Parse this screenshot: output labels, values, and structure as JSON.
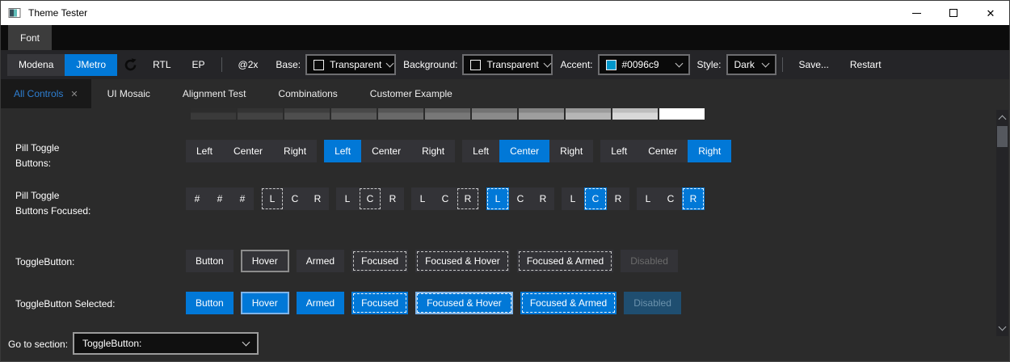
{
  "window": {
    "title": "Theme Tester",
    "controls": {
      "minimize": "minimize",
      "maximize": "maximize",
      "close": "✕"
    }
  },
  "menubar": {
    "font": "Font"
  },
  "toolbar": {
    "modena": "Modena",
    "jmetro": "JMetro",
    "rtl": "RTL",
    "ep": "EP",
    "scale": "@2x",
    "base_label": "Base:",
    "base_value": "Transparent",
    "background_label": "Background:",
    "background_value": "Transparent",
    "accent_label": "Accent:",
    "accent_value": "#0096c9",
    "accent_color": "#0096c9",
    "style_label": "Style:",
    "style_value": "Dark",
    "save": "Save...",
    "restart": "Restart"
  },
  "tabs": [
    {
      "label": "All Controls",
      "close": "✕",
      "selected": true
    },
    {
      "label": "UI Mosaic"
    },
    {
      "label": "Alignment Test"
    },
    {
      "label": "Combinations"
    },
    {
      "label": "Customer Example"
    }
  ],
  "colors": {
    "accent_button_blue": "#0178d7",
    "button_gray": "#333337",
    "disabled_selected_bg": "#1f4e70",
    "content_bg": "#2b2b2b"
  },
  "swatch_strip": {
    "blocks": [
      {
        "top": "#2c2c2c",
        "bottom": "#3a3a3a"
      },
      {
        "top": "#333333",
        "bottom": "#424242"
      },
      {
        "top": "#3d3d3d",
        "bottom": "#4e4e4e"
      },
      {
        "top": "#484848",
        "bottom": "#5a5a5a"
      },
      {
        "top": "#555555",
        "bottom": "#696969"
      },
      {
        "top": "#636363",
        "bottom": "#787878"
      },
      {
        "top": "#737373",
        "bottom": "#8a8a8a"
      },
      {
        "top": "#858585",
        "bottom": "#9e9e9e"
      },
      {
        "top": "#9b9b9b",
        "bottom": "#b6b6b6"
      },
      {
        "top": "#bdbdbd",
        "bottom": "#d8d8d8"
      },
      {
        "top": "#ffffff",
        "bottom": "#ffffff"
      }
    ]
  },
  "rows": {
    "pill": {
      "label": "Pill Toggle Buttons:",
      "groups": [
        {
          "buttons": [
            {
              "label": "Left"
            },
            {
              "label": "Center"
            },
            {
              "label": "Right"
            }
          ]
        },
        {
          "buttons": [
            {
              "label": "Left",
              "state": "selected"
            },
            {
              "label": "Center"
            },
            {
              "label": "Right"
            }
          ]
        },
        {
          "buttons": [
            {
              "label": "Left"
            },
            {
              "label": "Center",
              "state": "selected"
            },
            {
              "label": "Right"
            }
          ]
        },
        {
          "buttons": [
            {
              "label": "Left"
            },
            {
              "label": "Center"
            },
            {
              "label": "Right",
              "state": "selected"
            }
          ]
        }
      ]
    },
    "pill_focused": {
      "label": "Pill Toggle Buttons Focused:",
      "groups": [
        {
          "buttons": [
            {
              "label": "#"
            },
            {
              "label": "#"
            },
            {
              "label": "#"
            }
          ]
        },
        {
          "buttons": [
            {
              "label": "L",
              "state": "focused"
            },
            {
              "label": "C"
            },
            {
              "label": "R"
            }
          ]
        },
        {
          "buttons": [
            {
              "label": "L"
            },
            {
              "label": "C",
              "state": "focused"
            },
            {
              "label": "R"
            }
          ]
        },
        {
          "buttons": [
            {
              "label": "L"
            },
            {
              "label": "C"
            },
            {
              "label": "R",
              "state": "focused"
            }
          ]
        },
        {
          "buttons": [
            {
              "label": "L",
              "state": "selected focused"
            },
            {
              "label": "C"
            },
            {
              "label": "R"
            }
          ]
        },
        {
          "buttons": [
            {
              "label": "L"
            },
            {
              "label": "C",
              "state": "selected focused"
            },
            {
              "label": "R"
            }
          ]
        },
        {
          "buttons": [
            {
              "label": "L"
            },
            {
              "label": "C"
            },
            {
              "label": "R",
              "state": "selected focused"
            }
          ]
        }
      ]
    },
    "toggle": {
      "label": "ToggleButton:",
      "buttons": [
        {
          "label": "Button"
        },
        {
          "label": "Hover",
          "state": "hover"
        },
        {
          "label": "Armed",
          "state": "armed"
        },
        {
          "label": "Focused",
          "state": "focused"
        },
        {
          "label": "Focused & Hover",
          "state": "focused hover"
        },
        {
          "label": "Focused & Armed",
          "state": "focused armed"
        },
        {
          "label": "Disabled",
          "state": "disabled"
        }
      ]
    },
    "toggle_selected": {
      "label": "ToggleButton Selected:",
      "buttons": [
        {
          "label": "Button",
          "state": "selected"
        },
        {
          "label": "Hover",
          "state": "selected hover"
        },
        {
          "label": "Armed",
          "state": "selected armed"
        },
        {
          "label": "Focused",
          "state": "selected focused"
        },
        {
          "label": "Focused & Hover",
          "state": "selected focused hover"
        },
        {
          "label": "Focused & Armed",
          "state": "selected focused armed"
        },
        {
          "label": "Disabled",
          "state": "selected disabled"
        }
      ]
    }
  },
  "footer": {
    "label": "Go to section:",
    "value": "ToggleButton:"
  }
}
